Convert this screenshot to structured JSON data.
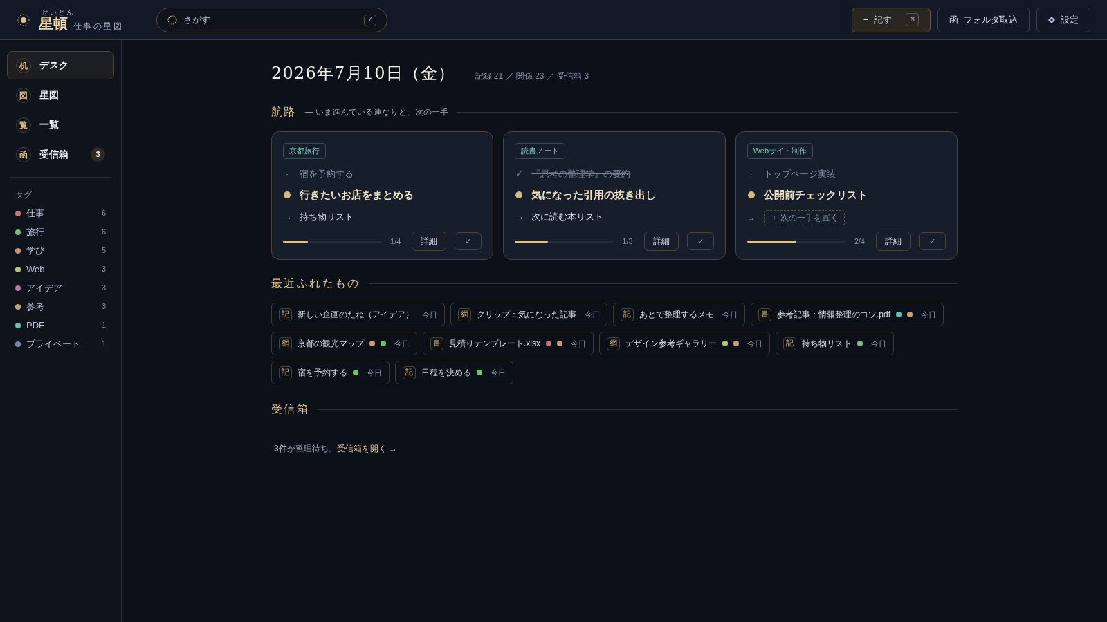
{
  "header": {
    "logo_ruby": "せいとん",
    "logo": "星頓",
    "tagline": "仕事の星図",
    "search": {
      "placeholder": "さがす",
      "shortcut": "/"
    },
    "buttons": [
      {
        "kind": "primary",
        "icon": "+",
        "label": "記す",
        "shortcut": "N"
      },
      {
        "kind": "plain",
        "icon": "函",
        "label": "フォルダ取込"
      },
      {
        "kind": "settings",
        "label": "設定"
      }
    ]
  },
  "sidebar": {
    "items": [
      {
        "icon": "机",
        "label": "デスク",
        "selected": true
      },
      {
        "icon": "図",
        "label": "星図",
        "selected": false
      },
      {
        "icon": "覧",
        "label": "一覧",
        "selected": false
      },
      {
        "icon": "函",
        "label": "受信箱",
        "selected": false,
        "badge": "3"
      }
    ],
    "tags_title": "タグ",
    "tags": [
      {
        "name": "仕事",
        "count": "6",
        "color": "#d07272"
      },
      {
        "name": "旅行",
        "count": "6",
        "color": "#6cc46e"
      },
      {
        "name": "学び",
        "count": "5",
        "color": "#d0906e"
      },
      {
        "name": "Web",
        "count": "3",
        "color": "#b8c86e"
      },
      {
        "name": "アイデア",
        "count": "3",
        "color": "#c872a8"
      },
      {
        "name": "参考",
        "count": "3",
        "color": "#c8a072"
      },
      {
        "name": "PDF",
        "count": "1",
        "color": "#62c2b2"
      },
      {
        "name": "プライベート",
        "count": "1",
        "color": "#7282c8"
      }
    ]
  },
  "main": {
    "date": "2026年7月10日（金）",
    "stats": "記録 21 ／ 関係 23 ／ 受信箱 3",
    "route": {
      "title": "航路",
      "subtitle": "— いま進んでいる連なりと、次の一手",
      "cards": [
        {
          "tag": "京都旅行",
          "steps": [
            {
              "kind": "past",
              "mark": "·",
              "text": "宿を予約する"
            },
            {
              "kind": "current",
              "text": "行きたいお店をまとめる"
            },
            {
              "kind": "next",
              "mark": "→",
              "text": "持ち物リスト"
            }
          ],
          "level": 0.25,
          "progress": "1/4",
          "detail": "詳細",
          "done": "✓"
        },
        {
          "tag": "読書ノート",
          "steps": [
            {
              "kind": "done",
              "mark": "✓",
              "text": "『思考の整理学』の要約"
            },
            {
              "kind": "current",
              "text": "気になった引用の抜き出し"
            },
            {
              "kind": "next",
              "mark": "→",
              "text": "次に読む本リスト"
            }
          ],
          "level": 0.333,
          "progress": "1/3",
          "detail": "詳細",
          "done": "✓"
        },
        {
          "tag": "Webサイト制作",
          "steps": [
            {
              "kind": "past",
              "mark": "·",
              "text": "トップページ実装"
            },
            {
              "kind": "current",
              "text": "公開前チェックリスト"
            },
            {
              "kind": "add",
              "mark": "→",
              "text": "＋ 次の一手を置く"
            }
          ],
          "level": 0.5,
          "progress": "2/4",
          "detail": "詳細",
          "done": "✓"
        }
      ]
    },
    "recent": {
      "title": "最近ふれたもの",
      "items": [
        {
          "icon": "記",
          "label": "新しい企画のたね（アイデア）",
          "time": "今日"
        },
        {
          "icon": "網",
          "label": "クリップ：気になった記事",
          "time": "今日"
        },
        {
          "icon": "記",
          "label": "あとで整理するメモ",
          "time": "今日"
        },
        {
          "icon": "書",
          "label": "参考記事：情報整理のコツ.pdf",
          "dots": [
            {
              "color": "#62c2b2"
            },
            {
              "color": "#c8a072"
            }
          ],
          "time": "今日"
        },
        {
          "icon": "網",
          "label": "京都の観光マップ",
          "dots": [
            {
              "color": "#c8a072"
            },
            {
              "color": "#6cc46e"
            }
          ],
          "time": "今日"
        },
        {
          "icon": "書",
          "label": "見積りテンプレート.xlsx",
          "dots": [
            {
              "color": "#d07272"
            },
            {
              "color": "#c8a072"
            }
          ],
          "time": "今日"
        },
        {
          "icon": "網",
          "label": "デザイン参考ギャラリー",
          "dots": [
            {
              "color": "#b8c86e"
            },
            {
              "color": "#c8a072"
            }
          ],
          "time": "今日"
        },
        {
          "icon": "記",
          "label": "持ち物リスト",
          "dots": [
            {
              "color": "#6cc46e"
            }
          ],
          "time": "今日"
        },
        {
          "icon": "記",
          "label": "宿を予約する",
          "dots": [
            {
              "color": "#6cc46e"
            }
          ],
          "time": "今日"
        },
        {
          "icon": "記",
          "label": "日程を決める",
          "dots": [
            {
              "color": "#6cc46e"
            }
          ],
          "time": "今日"
        }
      ]
    },
    "inbox": {
      "title": "受信箱",
      "text": "**3件**が整理待ち。",
      "link": "受信箱を開く →"
    }
  }
}
